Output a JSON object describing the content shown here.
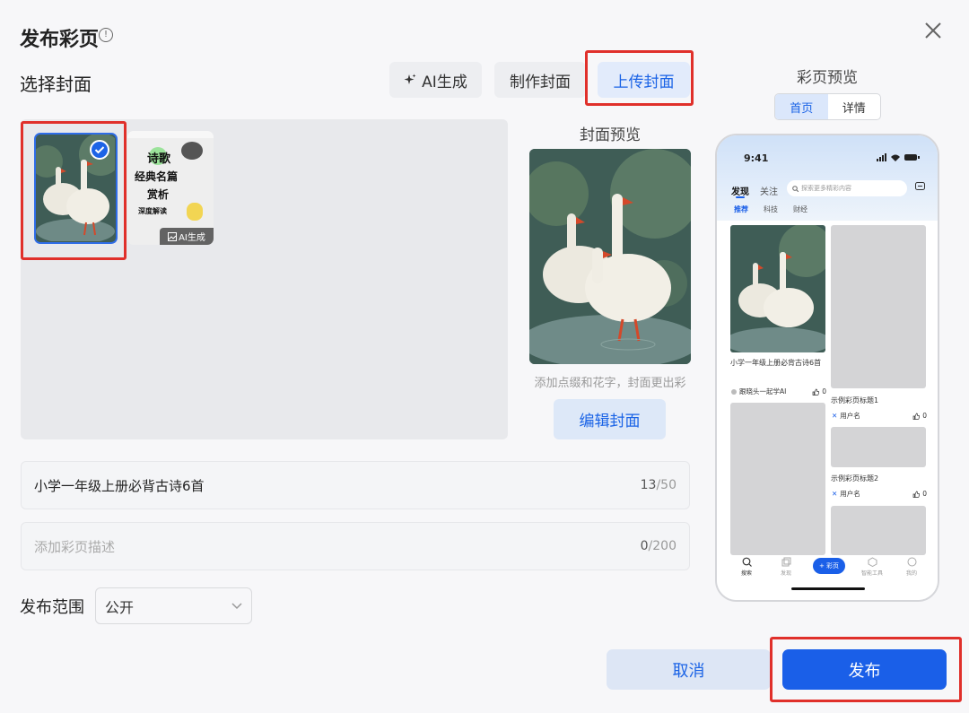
{
  "dialog": {
    "title": "发布彩页",
    "section_cover": "选择封面",
    "tabs": [
      {
        "label": "AI生成"
      },
      {
        "label": "制作封面"
      },
      {
        "label": "上传封面"
      }
    ],
    "thumbnail2": {
      "lines": [
        "诗歌",
        "经典名篇",
        "赏析",
        "深度解读"
      ],
      "badge": "AI生成"
    },
    "cover_preview_label": "封面预览",
    "cover_hint": "添加点缀和花字，封面更出彩",
    "edit_cover_label": "编辑封面",
    "title_field": {
      "value": "小学一年级上册必背古诗6首",
      "count": "13",
      "max": "/50"
    },
    "desc_field": {
      "placeholder": "添加彩页描述",
      "count": "0",
      "max": "/200"
    },
    "scope_label": "发布范围",
    "scope_value": "公开",
    "cancel_label": "取消",
    "publish_label": "发布"
  },
  "preview": {
    "title": "彩页预览",
    "segments": [
      "首页",
      "详情"
    ],
    "phone": {
      "time": "9:41",
      "tabs": [
        "发现",
        "关注"
      ],
      "search_placeholder": "探索更多精彩内容",
      "subtabs": [
        "推荐",
        "科技",
        "财经"
      ],
      "card1_title": "小学一年级上册必背古诗6首",
      "card1_author": "跟晓头一起学AI",
      "card1_likes": "0",
      "card2_title": "示例彩页标题1",
      "card2_author": "用户名",
      "card2_likes": "0",
      "card3_title": "示例彩页标题2",
      "card3_author": "用户名",
      "card3_likes": "0",
      "nav": [
        "搜索",
        "发现",
        "+ 彩页",
        "智能工具",
        "我的"
      ]
    }
  },
  "colors": {
    "accent": "#1a5fe8",
    "highlight_border": "#e0302b",
    "selected_tab_bg": "#e2ebfb"
  }
}
